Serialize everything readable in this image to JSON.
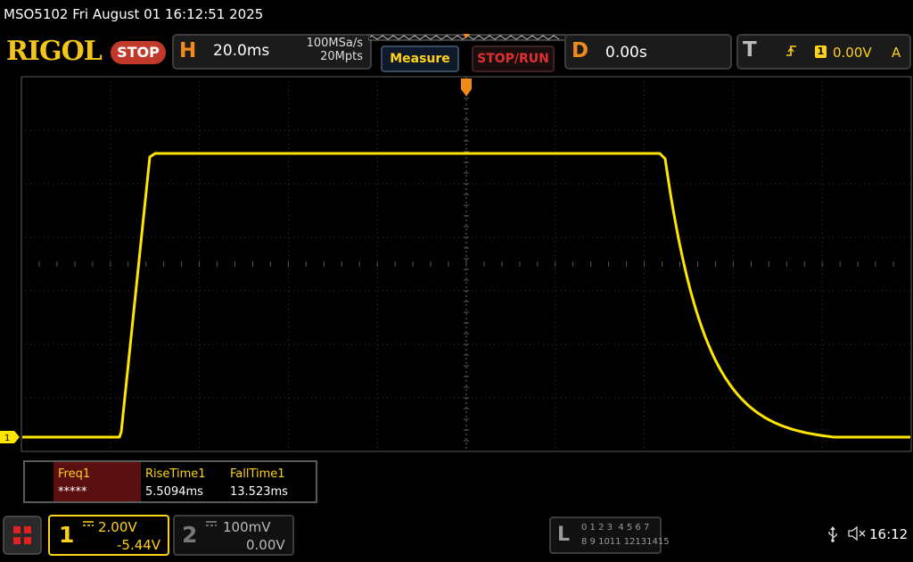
{
  "title_bar": {
    "text": "MSO5102  Fri August 01 16:12:51 2025"
  },
  "brand": {
    "logo": "RIGOL",
    "status": "STOP"
  },
  "horizontal": {
    "letter": "H",
    "timebase": "20.0ms",
    "sample_rate": "100MSa/s",
    "memory_depth": "20Mpts"
  },
  "buttons": {
    "measure": "Measure",
    "stop_run": "STOP/RUN"
  },
  "delay": {
    "letter": "D",
    "value": "0.00s"
  },
  "trigger": {
    "letter": "T",
    "slope_icon": "rising-edge-icon",
    "source": "1",
    "level": "0.00V",
    "mode": "A"
  },
  "measurements": [
    {
      "label": "Freq1",
      "value": "*****"
    },
    {
      "label": "RiseTime1",
      "value": "5.5094ms"
    },
    {
      "label": "FallTime1",
      "value": "13.523ms"
    }
  ],
  "channel1": {
    "number": "1",
    "coupling_icon": "dc-coupling-icon",
    "scale": "2.00V",
    "offset": "-5.44V",
    "marker": "1",
    "color": "#ffe600"
  },
  "channel2": {
    "number": "2",
    "coupling_icon": "dc-coupling-icon",
    "scale": "100mV",
    "offset": "0.00V"
  },
  "logic_analyzer": {
    "letter": "L",
    "row1": "0 1 2 3  4 5 6 7",
    "row2": "8 9 1011 12131415"
  },
  "status": {
    "usb_icon": "usb-icon",
    "sound_icon": "speaker-muted-icon",
    "time": "16:12"
  },
  "colors": {
    "accent": "#f3c51a",
    "trace": "#ffe600",
    "timebase_orange": "#f08a1a",
    "stop_red": "#c0392b"
  }
}
